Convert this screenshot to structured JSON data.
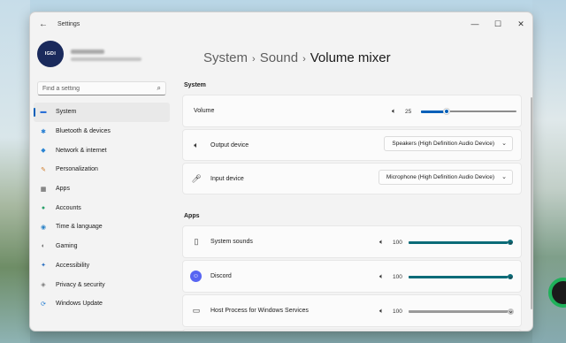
{
  "window": {
    "title": "Settings",
    "minimize": "—",
    "maximize": "☐",
    "close": "✕",
    "back": "←"
  },
  "profile": {
    "avatar_text": "ᴵᴳᴰᴵ"
  },
  "search": {
    "placeholder": "Find a setting"
  },
  "sidebar": {
    "items": [
      {
        "label": "System",
        "icon": "system-icon",
        "glyph": "▬",
        "color": "#2a6fd6",
        "active": true
      },
      {
        "label": "Bluetooth & devices",
        "icon": "bluetooth-icon",
        "glyph": "✱",
        "color": "#1f7ad1"
      },
      {
        "label": "Network & internet",
        "icon": "wifi-icon",
        "glyph": "◆",
        "color": "#2a84d2"
      },
      {
        "label": "Personalization",
        "icon": "brush-icon",
        "glyph": "✎",
        "color": "#d07b2a"
      },
      {
        "label": "Apps",
        "icon": "apps-icon",
        "glyph": "▦",
        "color": "#4a4a4a"
      },
      {
        "label": "Accounts",
        "icon": "accounts-icon",
        "glyph": "●",
        "color": "#2aa06a"
      },
      {
        "label": "Time & language",
        "icon": "globe-icon",
        "glyph": "◉",
        "color": "#2b82c7"
      },
      {
        "label": "Gaming",
        "icon": "gamepad-icon",
        "glyph": "◐",
        "color": "#6a6a6a"
      },
      {
        "label": "Accessibility",
        "icon": "accessibility-icon",
        "glyph": "✦",
        "color": "#2b6fc0"
      },
      {
        "label": "Privacy & security",
        "icon": "shield-icon",
        "glyph": "◈",
        "color": "#7a7a7a"
      },
      {
        "label": "Windows Update",
        "icon": "update-icon",
        "glyph": "⟳",
        "color": "#1f7ad1"
      }
    ]
  },
  "breadcrumb": {
    "part1": "System",
    "part2": "Sound",
    "current": "Volume mixer",
    "sep": "›"
  },
  "system_section": {
    "heading": "System",
    "volume": {
      "label": "Volume",
      "value": "25",
      "level": 0.25
    },
    "output": {
      "label": "Output device",
      "selected": "Speakers (High Definition Audio Device)"
    },
    "input": {
      "label": "Input device",
      "selected": "Microphone (High Definition Audio Device)"
    }
  },
  "apps_section": {
    "heading": "Apps",
    "apps": [
      {
        "name": "System sounds",
        "value": "100",
        "level": 1.0,
        "style": "teal",
        "icon": "speaker-box-icon"
      },
      {
        "name": "Discord",
        "value": "100",
        "level": 1.0,
        "style": "teal",
        "icon": "discord-icon"
      },
      {
        "name": "Host Process for Windows Services",
        "value": "100",
        "level": 1.0,
        "style": "gray",
        "icon": "windows-service-icon"
      }
    ]
  },
  "colors": {
    "accent": "#005fb8",
    "app_slider": "#0a6b78"
  }
}
